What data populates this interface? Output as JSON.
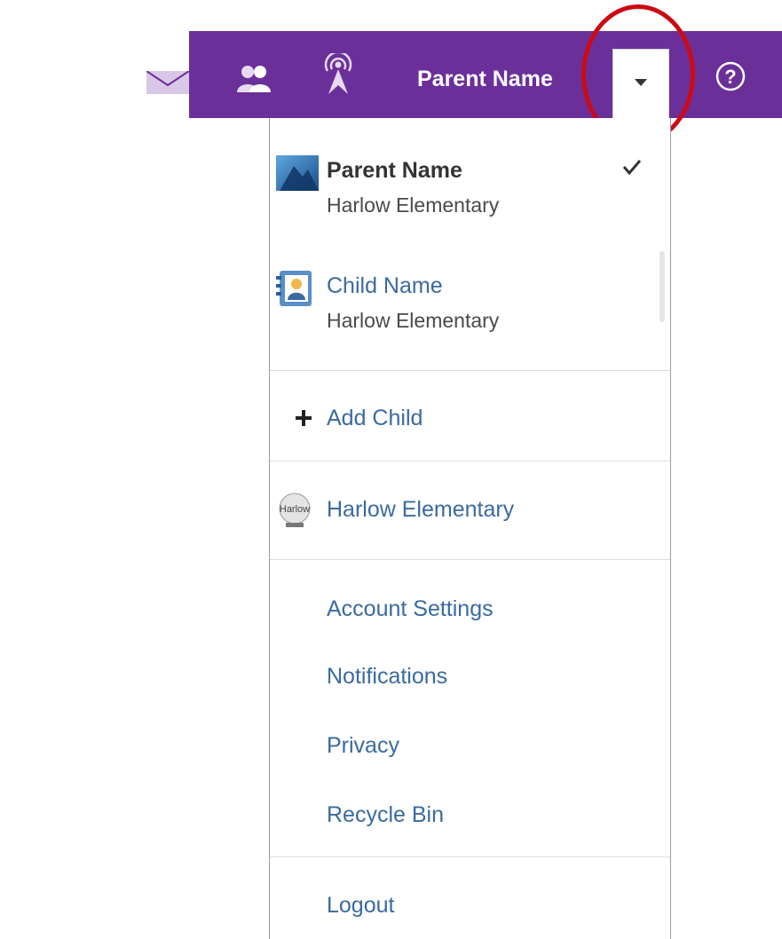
{
  "header": {
    "background": "#6b2f9a",
    "icons": [
      "mail-icon",
      "people-icon",
      "radar-icon",
      "help-icon"
    ],
    "user_name": "Parent Name",
    "dropdown_icon": "chevron-down-icon",
    "help_glyph": "?"
  },
  "menu": {
    "accounts": [
      {
        "name": "Parent Name",
        "school": "Harlow Elementary",
        "selected": true,
        "icon": "parent-avatar-icon"
      },
      {
        "name": "Child Name",
        "school": "Harlow Elementary",
        "selected": false,
        "icon": "child-contact-icon"
      }
    ],
    "add_child": {
      "symbol": "+",
      "label": "Add Child"
    },
    "school_link": {
      "label": "Harlow Elementary",
      "icon": "school-logo-icon",
      "logo_text": "Harlow"
    },
    "settings_items": [
      "Account Settings",
      "Notifications",
      "Privacy",
      "Recycle Bin"
    ],
    "logout_label": "Logout"
  },
  "colors": {
    "accent": "#6b2f9a",
    "link": "#3a6aa0",
    "highlight_ring": "#cc0a14"
  }
}
